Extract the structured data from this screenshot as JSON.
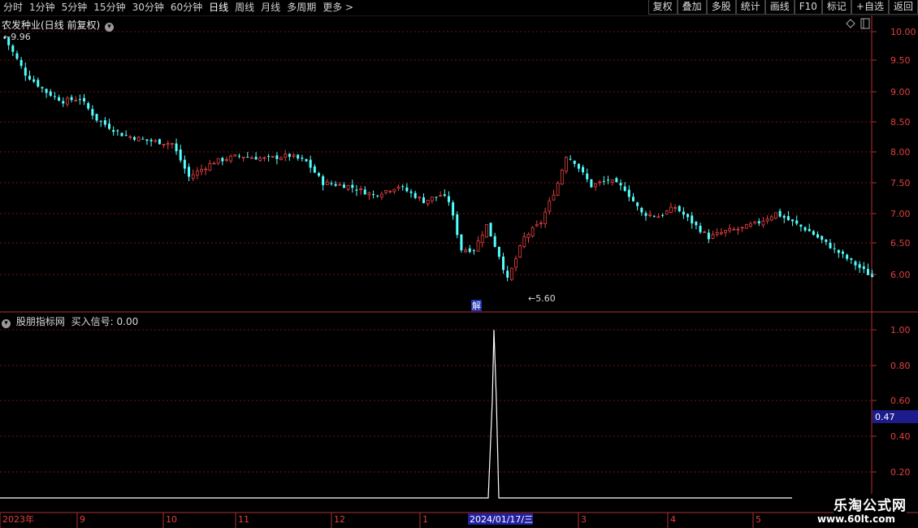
{
  "toolbar": {
    "periods": [
      "分时",
      "1分钟",
      "5分钟",
      "15分钟",
      "30分钟",
      "60分钟",
      "日线",
      "周线",
      "月线",
      "多周期",
      "更多 >"
    ],
    "active_period": "日线",
    "right_buttons": [
      "复权",
      "叠加",
      "多股",
      "统计",
      "画线",
      "F10",
      "标记",
      "+自选",
      "返回"
    ]
  },
  "main_panel": {
    "title": "农发种业(日线 前复权)",
    "high_marker": "9.96",
    "low_marker": "5.60",
    "jie_badge": "解",
    "y_ticks": [
      "10.00",
      "9.50",
      "9.00",
      "8.50",
      "8.00",
      "7.50",
      "7.00",
      "6.50",
      "6.00"
    ]
  },
  "indicator_panel": {
    "title": "股朋指标网",
    "signal_label": "买入信号:",
    "signal_value": "0.00",
    "y_ticks": [
      "1.00",
      "0.80",
      "0.60",
      "0.40",
      "0.20"
    ],
    "current_value": "0.47"
  },
  "x_axis": {
    "labels": [
      "2023年",
      "9",
      "10",
      "11",
      "12",
      "1",
      "2024/01/17/三",
      "3",
      "4",
      "5"
    ]
  },
  "watermark": {
    "line1": "乐淘公式网",
    "line2": "www.60lt.com"
  },
  "colors": {
    "up": "#e84040",
    "down": "#54ffff",
    "grid": "#7a1010",
    "axis": "#b03030",
    "highlight": "#2020a0"
  }
}
